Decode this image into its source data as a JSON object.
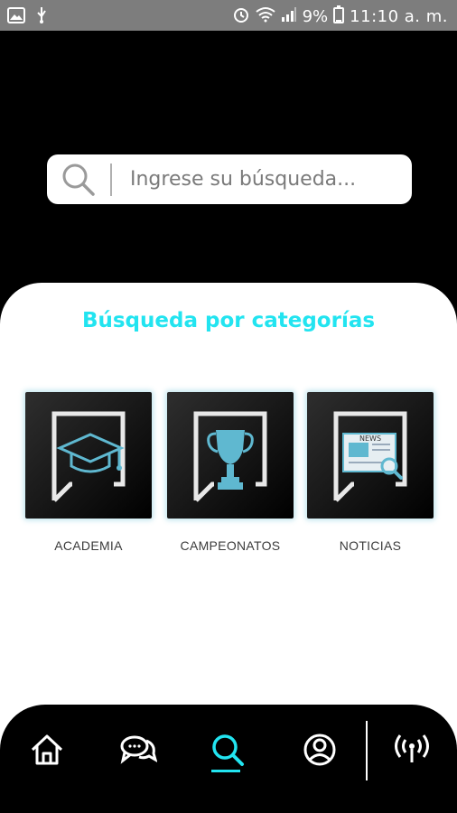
{
  "status_bar": {
    "battery": "9%",
    "time": "11:10 a. m.",
    "icons": [
      "image-icon",
      "usb-icon",
      "alarm-icon",
      "wifi-icon",
      "signal-icon",
      "battery-icon"
    ]
  },
  "search": {
    "placeholder": "Ingrese su búsqueda...",
    "value": ""
  },
  "categories": {
    "title": "Búsqueda por categorías",
    "items": [
      {
        "label": "ACADEMIA",
        "icon": "graduation-cap-icon"
      },
      {
        "label": "CAMPEONATOS",
        "icon": "trophy-icon"
      },
      {
        "label": "NOTICIAS",
        "icon": "newspaper-icon"
      }
    ],
    "news_text": "NEWS"
  },
  "bottom_nav": {
    "items": [
      "home-icon",
      "chat-icon",
      "search-icon",
      "profile-icon",
      "broadcast-icon"
    ],
    "active": "search-icon"
  },
  "colors": {
    "accent": "#22e4f0",
    "icon_blue": "#5fb8d0",
    "background": "#000000",
    "panel": "#ffffff",
    "status_bar": "#7d7d7d"
  }
}
